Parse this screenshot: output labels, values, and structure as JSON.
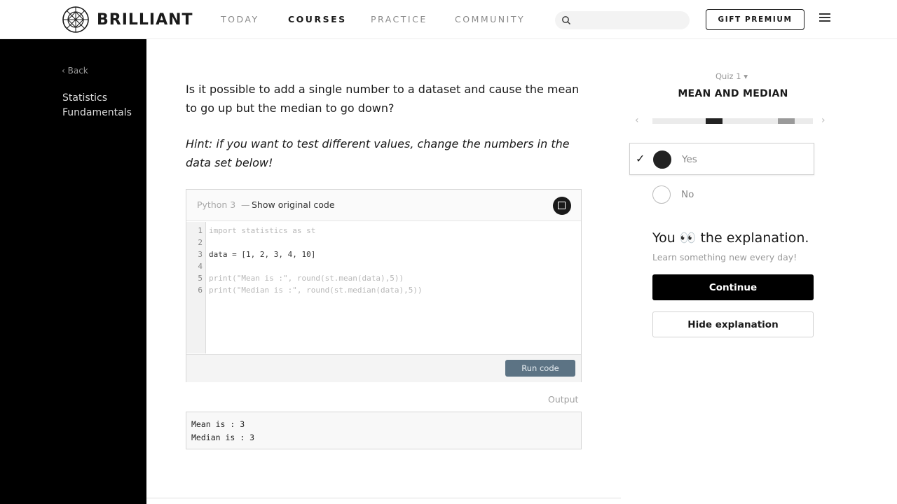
{
  "brand": {
    "name": "BRILLIANT"
  },
  "nav": {
    "items": [
      {
        "label": "TODAY",
        "active": false
      },
      {
        "label": "COURSES",
        "active": true
      },
      {
        "label": "PRACTICE",
        "active": false
      },
      {
        "label": "COMMUNITY",
        "active": false
      }
    ],
    "gift_label": "GIFT PREMIUM"
  },
  "sidebar": {
    "back_label": "‹ Back",
    "course_title": "Statistics Fundamentals"
  },
  "problem": {
    "question": "Is it possible to add a single number to a dataset and cause the mean to go up but the median to go down?",
    "hint": "Hint: if you want to test different values, change the numbers in the data set below!"
  },
  "code": {
    "language": "Python 3",
    "separator": "—",
    "show_original": "Show original code",
    "lines": [
      {
        "no": "1",
        "text": "import statistics as st"
      },
      {
        "no": "2",
        "text": ""
      },
      {
        "no": "3",
        "text": "data = [1, 2, 3, 4, 10]"
      },
      {
        "no": "4",
        "text": ""
      },
      {
        "no": "5",
        "text": "print(\"Mean is :\", round(st.mean(data),5))"
      },
      {
        "no": "6",
        "text": "print(\"Median is :\", round(st.median(data),5))"
      }
    ],
    "run_label": "Run code"
  },
  "output": {
    "label": "Output",
    "lines": [
      "Mean is : 3",
      "Median is : 3"
    ]
  },
  "quiz": {
    "label": "Quiz 1 ▾",
    "title": "MEAN AND MEDIAN",
    "prev_icon": "‹",
    "next_icon": "›",
    "options": [
      {
        "label": "Yes",
        "selected": true,
        "check": "✓"
      },
      {
        "label": "No",
        "selected": false
      }
    ]
  },
  "explanation": {
    "title": "You 👀 the explanation.",
    "subtitle": "Learn something new every day!",
    "continue_label": "Continue",
    "hide_label": "Hide explanation"
  },
  "colors": {
    "sidebar_bg": "#000000",
    "run_button": "#5c7384",
    "continue_button": "#000000"
  }
}
